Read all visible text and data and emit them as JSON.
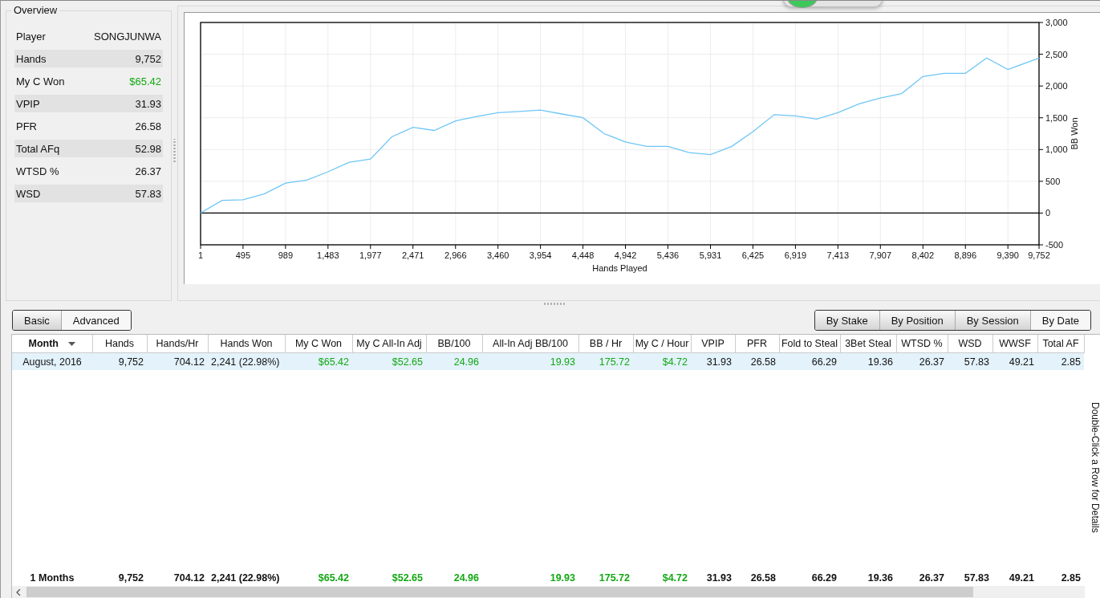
{
  "overview": {
    "title": "Overview",
    "stats": [
      {
        "label": "Player",
        "value": "SONGJUNWA",
        "positive": false
      },
      {
        "label": "Hands",
        "value": "9,752",
        "positive": false
      },
      {
        "label": "My C Won",
        "value": "$65.42",
        "positive": true
      },
      {
        "label": "VPIP",
        "value": "31.93",
        "positive": false
      },
      {
        "label": "PFR",
        "value": "26.58",
        "positive": false
      },
      {
        "label": "Total AFq",
        "value": "52.98",
        "positive": false
      },
      {
        "label": "WTSD %",
        "value": "26.37",
        "positive": false
      },
      {
        "label": "WSD",
        "value": "57.83",
        "positive": false
      }
    ]
  },
  "chart": {
    "chart_data": {
      "type": "line",
      "xlabel": "Hands Played",
      "ylabel": "BB Won",
      "x": [
        1,
        250,
        495,
        740,
        989,
        1236,
        1483,
        1730,
        1977,
        2224,
        2471,
        2718,
        2966,
        3213,
        3460,
        3707,
        3954,
        4201,
        4448,
        4695,
        4942,
        5189,
        5436,
        5683,
        5931,
        6178,
        6425,
        6672,
        6919,
        7166,
        7413,
        7660,
        7907,
        8154,
        8402,
        8649,
        8896,
        9143,
        9390,
        9630,
        9752
      ],
      "grid": true,
      "series": [
        {
          "color": "#6ec6f5",
          "values": [
            0,
            200,
            210,
            300,
            470,
            520,
            650,
            800,
            850,
            1200,
            1350,
            1300,
            1450,
            1520,
            1580,
            1600,
            1620,
            1560,
            1500,
            1250,
            1120,
            1050,
            1050,
            950,
            920,
            1050,
            1280,
            1550,
            1530,
            1480,
            1580,
            1720,
            1810,
            1880,
            2150,
            2200,
            2200,
            2440,
            2260,
            2380,
            2440
          ]
        }
      ],
      "xlim": [
        1,
        9752
      ],
      "ylim": [
        -500,
        3000
      ],
      "xticks": [
        {
          "value": 1,
          "label": "1"
        },
        {
          "value": 495,
          "label": "495"
        },
        {
          "value": 989,
          "label": "989"
        },
        {
          "value": 1483,
          "label": "1,483"
        },
        {
          "value": 1977,
          "label": "1,977"
        },
        {
          "value": 2471,
          "label": "2,471"
        },
        {
          "value": 2966,
          "label": "2,966"
        },
        {
          "value": 3460,
          "label": "3,460"
        },
        {
          "value": 3954,
          "label": "3,954"
        },
        {
          "value": 4448,
          "label": "4,448"
        },
        {
          "value": 4942,
          "label": "4,942"
        },
        {
          "value": 5436,
          "label": "5,436"
        },
        {
          "value": 5931,
          "label": "5,931"
        },
        {
          "value": 6425,
          "label": "6,425"
        },
        {
          "value": 6919,
          "label": "6,919"
        },
        {
          "value": 7413,
          "label": "7,413"
        },
        {
          "value": 7907,
          "label": "7,907"
        },
        {
          "value": 8402,
          "label": "8,402"
        },
        {
          "value": 8896,
          "label": "8,896"
        },
        {
          "value": 9390,
          "label": "9,390"
        },
        {
          "value": 9752,
          "label": "9,752"
        }
      ],
      "yticks": [
        {
          "value": -500,
          "label": "-500"
        },
        {
          "value": 0,
          "label": "0"
        },
        {
          "value": 500,
          "label": "500"
        },
        {
          "value": 1000,
          "label": "1,000"
        },
        {
          "value": 1500,
          "label": "1,500"
        },
        {
          "value": 2000,
          "label": "2,000"
        },
        {
          "value": 2500,
          "label": "2,500"
        },
        {
          "value": 3000,
          "label": "3,000"
        }
      ]
    }
  },
  "view_buttons": [
    {
      "label": "Basic",
      "selected": false
    },
    {
      "label": "Advanced",
      "selected": true
    }
  ],
  "group_buttons": [
    {
      "label": "By Stake",
      "selected": false
    },
    {
      "label": "By Position",
      "selected": false
    },
    {
      "label": "By Session",
      "selected": false
    },
    {
      "label": "By Date",
      "selected": true
    }
  ],
  "table": {
    "columns": [
      {
        "label": "Month",
        "positive": false,
        "sorted": true
      },
      {
        "label": "Hands",
        "positive": false,
        "sorted": false
      },
      {
        "label": "Hands/Hr",
        "positive": false,
        "sorted": false
      },
      {
        "label": "Hands Won",
        "positive": false,
        "sorted": false
      },
      {
        "label": "My C Won",
        "positive": true,
        "sorted": false
      },
      {
        "label": "My C All-In Adj",
        "positive": true,
        "sorted": false
      },
      {
        "label": "BB/100",
        "positive": true,
        "sorted": false
      },
      {
        "label": "All-In Adj BB/100",
        "positive": true,
        "sorted": false
      },
      {
        "label": "BB / Hr",
        "positive": true,
        "sorted": false
      },
      {
        "label": "My C / Hour",
        "positive": true,
        "sorted": false
      },
      {
        "label": "VPIP",
        "positive": false,
        "sorted": false
      },
      {
        "label": "PFR",
        "positive": false,
        "sorted": false
      },
      {
        "label": "Fold to Steal",
        "positive": false,
        "sorted": false
      },
      {
        "label": "3Bet Steal",
        "positive": false,
        "sorted": false
      },
      {
        "label": "WTSD %",
        "positive": false,
        "sorted": false
      },
      {
        "label": "WSD",
        "positive": false,
        "sorted": false
      },
      {
        "label": "WWSF",
        "positive": false,
        "sorted": false
      },
      {
        "label": "Total AF",
        "positive": false,
        "sorted": false
      }
    ],
    "rows": [
      {
        "selected": true,
        "cells": [
          "August, 2016",
          "9,752",
          "704.12",
          "2,241 (22.98%)",
          "$65.42",
          "$52.65",
          "24.96",
          "19.93",
          "175.72",
          "$4.72",
          "31.93",
          "26.58",
          "66.29",
          "19.36",
          "26.37",
          "57.83",
          "49.21",
          "2.85"
        ]
      }
    ],
    "totals": [
      "1 Months",
      "9,752",
      "704.12",
      "2,241 (22.98%)",
      "$65.42",
      "$52.65",
      "24.96",
      "19.93",
      "175.72",
      "$4.72",
      "31.93",
      "26.58",
      "66.29",
      "19.36",
      "26.37",
      "57.83",
      "49.21",
      "2.85"
    ]
  },
  "side_hint": "Double-Click a Row for Details"
}
